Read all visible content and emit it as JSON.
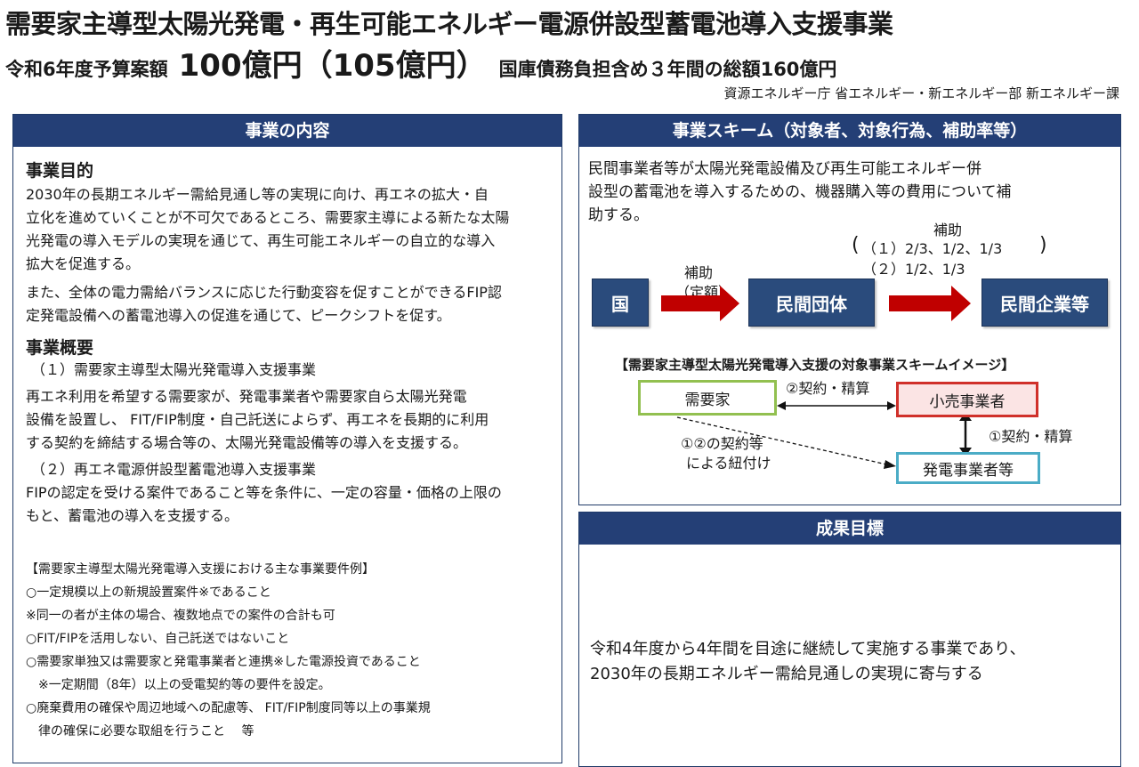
{
  "header": {
    "title": "需要家主導型太陽光発電・再生可能エネルギー電源併設型蓄電池導入支援事業",
    "budget_label": "令和6年度予算案額",
    "budget_amount": "100億円（105億円）",
    "budget_note": "国庫債務負担含め３年間の総額160億円",
    "agency": "資源エネルギー庁 省エネルギー・新エネルギー部 新エネルギー課"
  },
  "content": {
    "header": "事業の内容",
    "purpose_heading": "事業目的",
    "purpose_lines": [
      "2030年の長期エネルギー需給見通し等の実現に向け、再エネの拡大・自",
      "立化を進めていくことが不可欠であるところ、需要家主導による新たな太陽",
      "光発電の導入モデルの実現を通じて、再生可能エネルギーの自立的な導入",
      "拡大を促進する。"
    ],
    "purpose2_lines": [
      "また、全体の電力需給バランスに応じた行動変容を促すことができるFIP認",
      "定発電設備への蓄電池導入の促進を通じて、ピークシフトを促す。"
    ],
    "overview_heading": "事業概要",
    "item1_title": "（１）需要家主導型太陽光発電導入支援事業",
    "item1_lines": [
      "再エネ利用を希望する需要家が、発電事業者や需要家自ら太陽光発電",
      "設備を設置し、 FIT/FIP制度・自己託送によらず、再エネを長期的に利用",
      "する契約を締結する場合等の、太陽光発電設備等の導入を支援する。"
    ],
    "item2_title": "（２）再エネ電源併設型蓄電池導入支援事業",
    "item2_lines": [
      "FIPの認定を受ける案件であること等を条件に、一定の容量・価格の上限の",
      "もと、蓄電池の導入を支援する。"
    ],
    "req_heading": "【需要家主導型太陽光発電導入支援における主な事業要件例】",
    "req_lines": [
      "○一定規模以上の新規設置案件※であること",
      "※同一の者が主体の場合、複数地点での案件の合計も可",
      "○FIT/FIPを活用しない、自己託送ではないこと",
      "○需要家単独又は需要家と発電事業者と連携※した電源投資であること",
      "　※一定期間（8年）以上の受電契約等の要件を設定。",
      "○廃棄費用の確保や周辺地域への配慮等、 FIT/FIP制度同等以上の事業規",
      "　律の確保に必要な取組を行うこと　 等"
    ]
  },
  "scheme": {
    "header": "事業スキーム（対象者、対象行為、補助率等）",
    "description_lines": [
      "民間事業者等が太陽光発電設備及び再生可能エネルギー併",
      "設型の蓄電池を導入するための、機器購入等の費用について補",
      "助する。"
    ],
    "subsidy_label": "補助",
    "subsidy_rate_1": "（１）2/3、1/2、1/3",
    "subsidy_rate_2": "（２）1/2、1/3",
    "fixed_label_1": "補助",
    "fixed_label_2": "（定額）",
    "box_country": "国",
    "box_org": "民間団体",
    "box_company": "民間企業等",
    "image_title": "【需要家主導型太陽光発電導入支援の対象事業スキームイメージ】",
    "node_consumer": "需要家",
    "node_retailer": "小売事業者",
    "node_generator": "発電事業者等",
    "contract_2": "②契約・精算",
    "contract_1": "①契約・精算",
    "link_label_1": "①②の契約等",
    "link_label_2": "による紐付け",
    "colors": {
      "arrow": "#c00000",
      "box": "#2a4b7c",
      "consumer_border": "#92c050",
      "retailer_border": "#d0302a",
      "generator_border": "#4bacc6"
    }
  },
  "goal": {
    "header": "成果目標",
    "lines": [
      "令和4年度から4年間を目途に継続して実施する事業であり、",
      "2030年の長期エネルギー需給見通しの実現に寄与する"
    ]
  }
}
